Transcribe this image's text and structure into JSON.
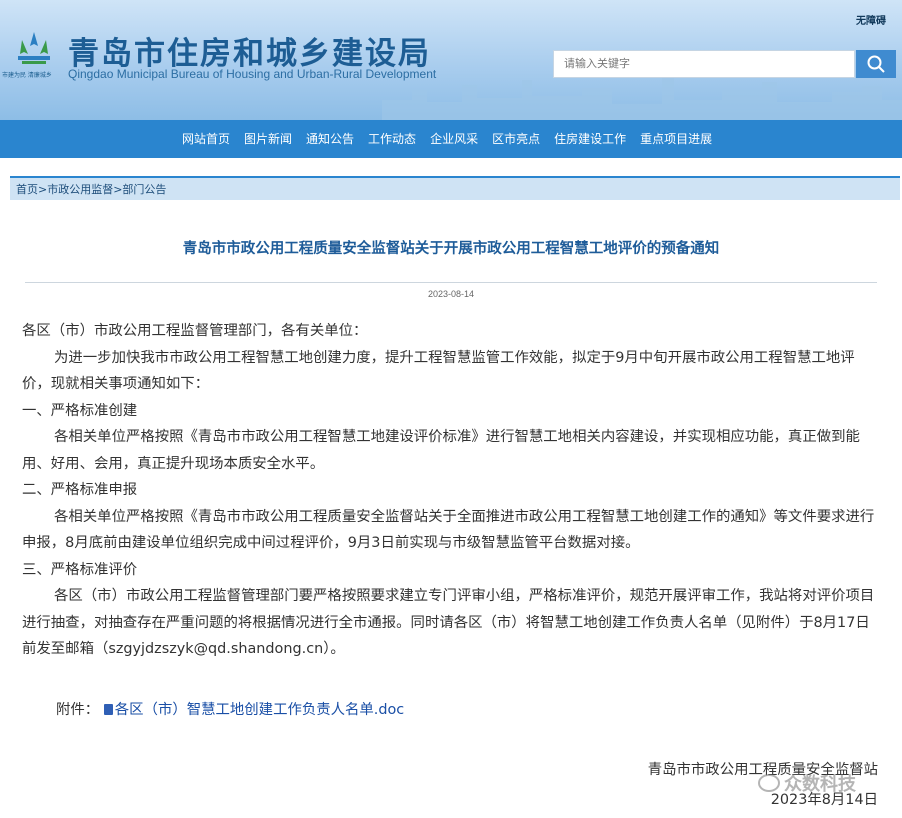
{
  "header": {
    "title_cn": "青岛市住房和城乡建设局",
    "title_en": "Qingdao Municipal Bureau of Housing and Urban-Rural Development",
    "slogan": "市建为民 清廉城乡",
    "accessibility": "无障碍",
    "search_placeholder": "请输入关键字"
  },
  "nav": {
    "items": [
      "网站首页",
      "图片新闻",
      "通知公告",
      "工作动态",
      "企业风采",
      "区市亮点",
      "住房建设工作",
      "重点项目进展"
    ]
  },
  "breadcrumb": "首页>市政公用监督>部门公告",
  "article": {
    "title": "青岛市市政公用工程质量安全监督站关于开展市政公用工程智慧工地评价的预备通知",
    "date": "2023-08-14",
    "salutation": "各区（市）市政公用工程监督管理部门，各有关单位：",
    "intro": "为进一步加快我市市政公用工程智慧工地创建力度，提升工程智慧监管工作效能，拟定于9月中旬开展市政公用工程智慧工地评价，现就相关事项通知如下：",
    "s1_title": "一、严格标准创建",
    "s1_body": "各相关单位严格按照《青岛市市政公用工程智慧工地建设评价标准》进行智慧工地相关内容建设，并实现相应功能，真正做到能用、好用、会用，真正提升现场本质安全水平。",
    "s2_title": "二、严格标准申报",
    "s2_body": "各相关单位严格按照《青岛市市政公用工程质量安全监督站关于全面推进市政公用工程智慧工地创建工作的通知》等文件要求进行申报，8月底前由建设单位组织完成中间过程评价，9月3日前实现与市级智慧监管平台数据对接。",
    "s3_title": "三、严格标准评价",
    "s3_body": "各区（市）市政公用工程监督管理部门要严格按照要求建立专门评审小组，严格标准评价，规范开展评审工作，我站将对评价项目进行抽查，对抽查存在严重问题的将根据情况进行全市通报。同时请各区（市）将智慧工地创建工作负责人名单（见附件）于8月17日前发至邮箱（szgyjdzszyk@qd.shandong.cn）。",
    "attachment_label": "附件：",
    "attachment_name": "各区（市）智慧工地创建工作负责人名单.doc",
    "signoff_org": "青岛市市政公用工程质量安全监督站",
    "signoff_date": "2023年8月14日"
  },
  "watermark": "众数科技",
  "colors": {
    "nav_bg": "#2a85cf",
    "title": "#1e5c99",
    "breadcrumb_bg": "#cfe3f4"
  }
}
